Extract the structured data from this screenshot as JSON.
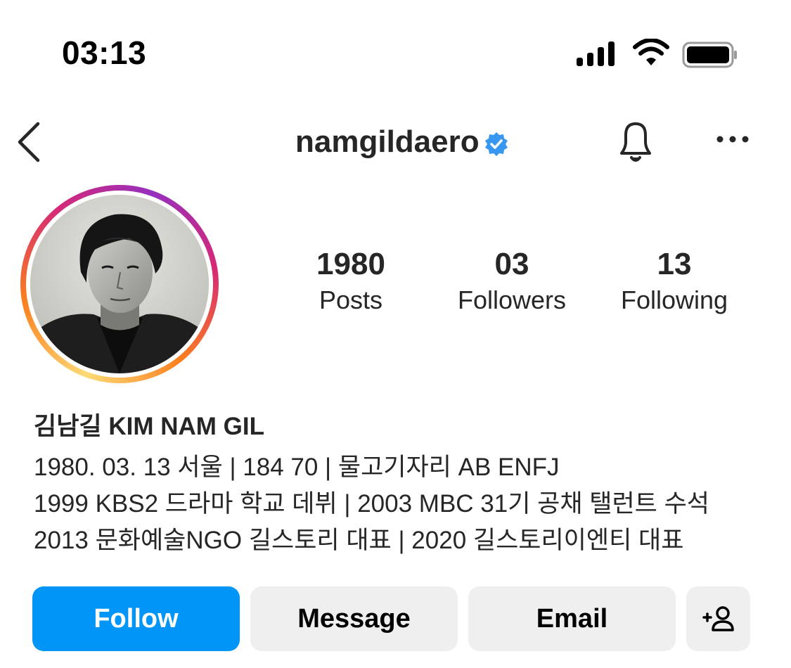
{
  "status_bar": {
    "time": "03:13"
  },
  "header": {
    "username": "namgildaero",
    "verified": true,
    "icons": [
      "back-icon",
      "verified-icon",
      "bell-icon",
      "more-icon"
    ]
  },
  "profile": {
    "stats": [
      {
        "value": "1980",
        "label": "Posts"
      },
      {
        "value": "03",
        "label": "Followers"
      },
      {
        "value": "13",
        "label": "Following"
      }
    ],
    "display_name": "김남길 KIM NAM GIL",
    "bio_lines": [
      "1980. 03. 13 서울 | 184 70 | 물고기자리 AB ENFJ",
      "1999 KBS2 드라마 학교 데뷔 | 2003 MBC 31기 공채 탤런트 수석",
      "2013 문화예술NGO 길스토리 대표 | 2020 길스토리이엔티 대표"
    ]
  },
  "actions": {
    "follow_label": "Follow",
    "message_label": "Message",
    "email_label": "Email",
    "add_user_icon": "add-person-icon"
  },
  "colors": {
    "follow_button": "#0095f6",
    "secondary_button": "#efefef",
    "verified_badge": "#3897f0",
    "text": "#262626"
  }
}
